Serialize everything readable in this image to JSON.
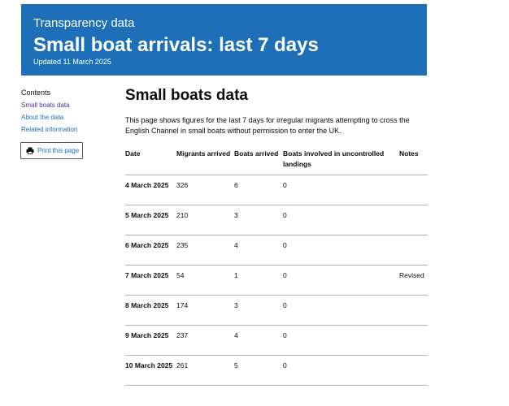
{
  "banner": {
    "context": "Transparency data",
    "title": "Small boat arrivals: last 7 days",
    "updated": "Updated 11 March 2025",
    "background": "#1d70b8"
  },
  "sidebar": {
    "contents_heading": "Contents",
    "links": [
      "Small boats data",
      "About the data",
      "Related information"
    ],
    "print_label": "Print this page",
    "print_icon": "printer-icon"
  },
  "main": {
    "heading": "Small boats data",
    "intro": "This page shows figures for the last 7 days for irregular migrants attempting to cross the English Channel in small boats without permission to enter the UK."
  },
  "table": {
    "headers": [
      "Date",
      "Migrants arrived",
      "Boats arrived",
      "Boats involved in uncontrolled landings",
      "Notes"
    ],
    "rows": [
      [
        "4 March 2025",
        "326",
        "6",
        "0",
        ""
      ],
      [
        "5 March 2025",
        "210",
        "3",
        "0",
        ""
      ],
      [
        "6 March 2025",
        "235",
        "4",
        "0",
        ""
      ],
      [
        "7 March 2025",
        "54",
        "1",
        "0",
        "Revised"
      ],
      [
        "8 March 2025",
        "174",
        "3",
        "0",
        ""
      ],
      [
        "9 March 2025",
        "237",
        "4",
        "0",
        ""
      ],
      [
        "10 March 2025",
        "261",
        "5",
        "0",
        ""
      ]
    ]
  },
  "colors": {
    "link": "#1d70b8",
    "visited_link": "#4c2c92",
    "text": "#0b0c0c"
  }
}
